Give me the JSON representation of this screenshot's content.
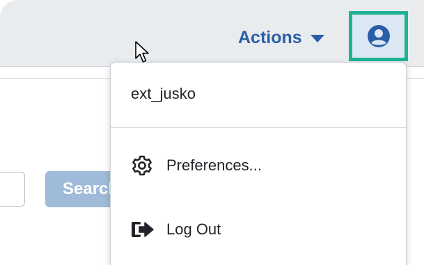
{
  "header": {
    "actions_label": "Actions",
    "user_icon": "user-circle-icon",
    "highlight_color": "#1db394",
    "accent_color": "#2b5ea7"
  },
  "main": {
    "search_label": "Search"
  },
  "user_menu": {
    "username": "ext_jusko",
    "items": [
      {
        "label": "Preferences...",
        "icon": "gear-icon"
      },
      {
        "label": "Log Out",
        "icon": "logout-icon"
      }
    ]
  }
}
